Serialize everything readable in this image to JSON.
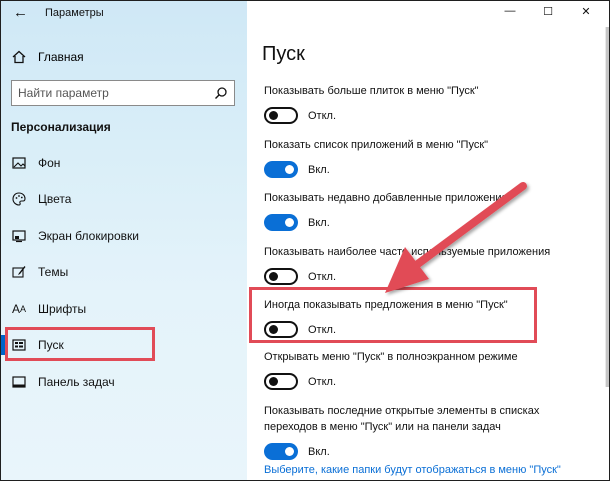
{
  "window": {
    "title": "Параметры"
  },
  "sidebar": {
    "home_label": "Главная",
    "search_placeholder": "Найти параметр",
    "section_title": "Персонализация",
    "items": [
      {
        "label": "Фон",
        "icon": "image-icon"
      },
      {
        "label": "Цвета",
        "icon": "palette-icon"
      },
      {
        "label": "Экран блокировки",
        "icon": "lock-screen-icon"
      },
      {
        "label": "Темы",
        "icon": "brush-icon"
      },
      {
        "label": "Шрифты",
        "icon": "font-icon"
      },
      {
        "label": "Пуск",
        "icon": "start-icon",
        "selected": true
      },
      {
        "label": "Панель задач",
        "icon": "taskbar-icon"
      }
    ]
  },
  "main": {
    "title": "Пуск",
    "settings": [
      {
        "label": "Показывать больше плиток в меню \"Пуск\"",
        "state": "Откл.",
        "on": false
      },
      {
        "label": "Показать список приложений в меню \"Пуск\"",
        "state": "Вкл.",
        "on": true
      },
      {
        "label": "Показывать недавно добавленные приложения",
        "state": "Вкл.",
        "on": true
      },
      {
        "label": "Показывать наиболее часто используемые приложения",
        "state": "Откл.",
        "on": false
      },
      {
        "label": "Иногда показывать предложения в меню \"Пуск\"",
        "state": "Откл.",
        "on": false
      },
      {
        "label": "Открывать меню \"Пуск\" в полноэкранном режиме",
        "state": "Откл.",
        "on": false
      },
      {
        "label_line1": "Показывать последние открытые элементы в списках",
        "label_line2": "переходов в меню \"Пуск\" или на панели задач",
        "state": "Вкл.",
        "on": true
      }
    ],
    "link": "Выберите, какие папки будут отображаться в меню \"Пуск\""
  },
  "colors": {
    "accent": "#0a6fd6",
    "highlight": "#e14b57"
  }
}
